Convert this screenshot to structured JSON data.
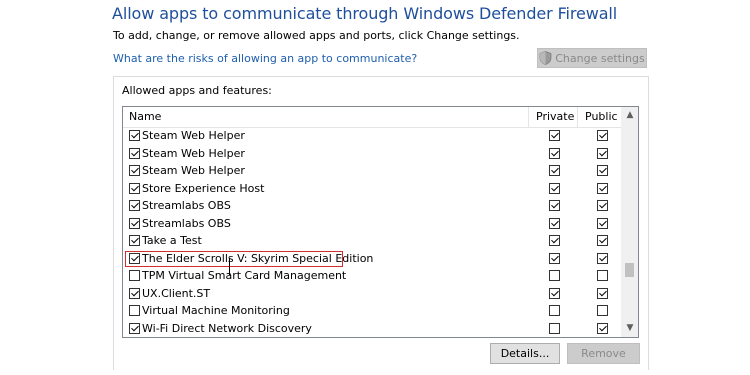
{
  "page": {
    "title": "Allow apps to communicate through Windows Defender Firewall",
    "subtitle": "To add, change, or remove allowed apps and ports, click Change settings.",
    "risk_link": "What are the risks of allowing an app to communicate?",
    "change_settings_label": "Change settings"
  },
  "group": {
    "label": "Allowed apps and features:",
    "columns": {
      "name": "Name",
      "private": "Private",
      "public": "Public"
    },
    "rows": [
      {
        "name": "Steam Web Helper",
        "checked": true,
        "private": true,
        "public": true
      },
      {
        "name": "Steam Web Helper",
        "checked": true,
        "private": true,
        "public": true
      },
      {
        "name": "Steam Web Helper",
        "checked": true,
        "private": true,
        "public": true
      },
      {
        "name": "Store Experience Host",
        "checked": true,
        "private": true,
        "public": true
      },
      {
        "name": "Streamlabs OBS",
        "checked": true,
        "private": true,
        "public": true
      },
      {
        "name": "Streamlabs OBS",
        "checked": true,
        "private": true,
        "public": true
      },
      {
        "name": "Take a Test",
        "checked": true,
        "private": true,
        "public": true
      },
      {
        "name": "The Elder Scrolls V: Skyrim Special Edition",
        "checked": true,
        "private": true,
        "public": true,
        "highlighted": true
      },
      {
        "name": "TPM Virtual Smart Card Management",
        "checked": false,
        "private": false,
        "public": false
      },
      {
        "name": "UX.Client.ST",
        "checked": true,
        "private": true,
        "public": true
      },
      {
        "name": "Virtual Machine Monitoring",
        "checked": false,
        "private": false,
        "public": false
      },
      {
        "name": "Wi-Fi Direct Network Discovery",
        "checked": true,
        "private": false,
        "public": true
      }
    ]
  },
  "buttons": {
    "details": "Details...",
    "remove": "Remove"
  },
  "colors": {
    "title": "#1e4f9c",
    "link": "#1e5fae",
    "highlight_border": "#d32f2f"
  },
  "icons": {
    "change_settings": "uac-shield-icon",
    "scroll_up": "chevron-up-icon",
    "scroll_down": "chevron-down-icon"
  }
}
